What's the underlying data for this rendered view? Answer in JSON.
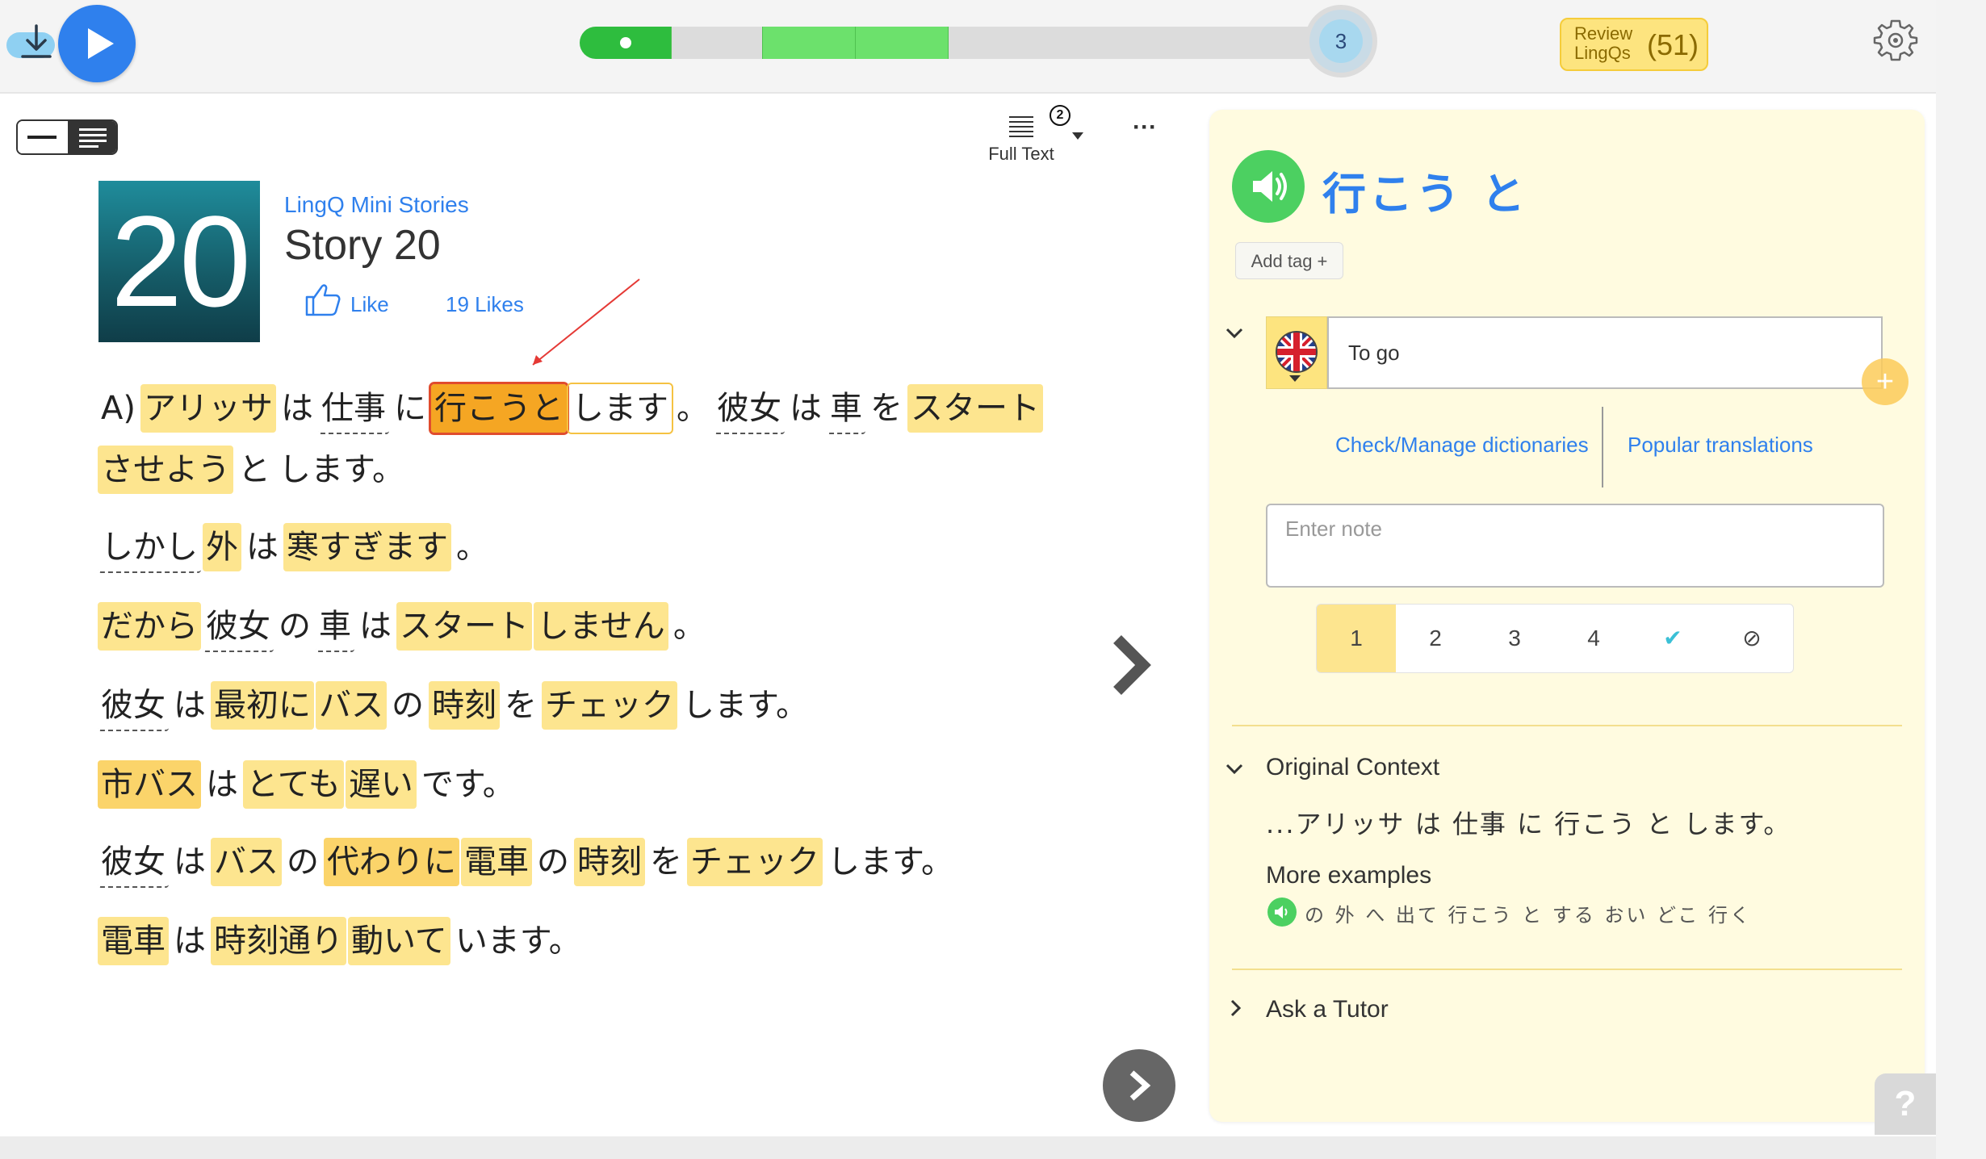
{
  "topbar": {
    "page_number": "3",
    "review_label": "Review LingQs",
    "review_count": "(51)",
    "progress_segments": [
      {
        "color": "#2ebd3e",
        "fraction": 0.123
      },
      {
        "color": "#dcdcdc",
        "fraction": 0.123
      },
      {
        "color": "#6ce16c",
        "fraction": 0.125
      },
      {
        "color": "#6ce16c",
        "fraction": 0.125
      },
      {
        "color": "#dcdcdc",
        "fraction": 0.504
      }
    ]
  },
  "toolbar": {
    "full_text_label": "Full Text",
    "full_text_badge": "2"
  },
  "lesson": {
    "cover_number": "20",
    "course": "LingQ Mini Stories",
    "title": "Story 20",
    "like_label": "Like",
    "likes_count": "19 Likes"
  },
  "paragraphs": [
    {
      "words": [
        {
          "t": "A)",
          "s": "plain"
        },
        {
          "t": "アリッサ",
          "s": "lingq"
        },
        {
          "t": "は",
          "s": "plain"
        },
        {
          "t": "仕事",
          "s": "known"
        },
        {
          "t": "に",
          "s": "plain"
        },
        {
          "t": "行こうと",
          "s": "selected"
        },
        {
          "t": "します",
          "s": "phrase"
        },
        {
          "t": "。",
          "s": "plain"
        },
        {
          "t": "彼女",
          "s": "known"
        },
        {
          "t": "は",
          "s": "plain"
        },
        {
          "t": "車",
          "s": "known"
        },
        {
          "t": "を",
          "s": "plain"
        },
        {
          "t": "スタート",
          "s": "lingq"
        }
      ]
    },
    {
      "words": [
        {
          "t": "させよう",
          "s": "lingq"
        },
        {
          "t": "と",
          "s": "plain"
        },
        {
          "t": "します。",
          "s": "plain"
        }
      ]
    },
    {
      "words": [
        {
          "t": "しかし",
          "s": "known"
        },
        {
          "t": "外",
          "s": "lingq"
        },
        {
          "t": "は",
          "s": "plain"
        },
        {
          "t": "寒すぎます",
          "s": "lingq"
        },
        {
          "t": "。",
          "s": "plain"
        }
      ]
    },
    {
      "words": [
        {
          "t": "だから",
          "s": "lingq"
        },
        {
          "t": "彼女",
          "s": "known"
        },
        {
          "t": "の",
          "s": "plain"
        },
        {
          "t": "車",
          "s": "known"
        },
        {
          "t": "は",
          "s": "plain"
        },
        {
          "t": "スタート",
          "s": "lingq"
        },
        {
          "t": "しません",
          "s": "lingq"
        },
        {
          "t": "。",
          "s": "plain"
        }
      ]
    },
    {
      "words": [
        {
          "t": "彼女",
          "s": "known"
        },
        {
          "t": "は",
          "s": "plain"
        },
        {
          "t": "最初に",
          "s": "lingq"
        },
        {
          "t": "バス",
          "s": "lingq"
        },
        {
          "t": "の",
          "s": "plain"
        },
        {
          "t": "時刻",
          "s": "lingq"
        },
        {
          "t": "を",
          "s": "plain"
        },
        {
          "t": "チェック",
          "s": "lingq"
        },
        {
          "t": "します。",
          "s": "plain"
        }
      ]
    },
    {
      "words": [
        {
          "t": "市バス",
          "s": "lingq2"
        },
        {
          "t": "は",
          "s": "plain"
        },
        {
          "t": "とても",
          "s": "lingq"
        },
        {
          "t": "遅い",
          "s": "lingq"
        },
        {
          "t": "です。",
          "s": "plain"
        }
      ]
    },
    {
      "words": [
        {
          "t": "彼女",
          "s": "known"
        },
        {
          "t": "は",
          "s": "plain"
        },
        {
          "t": "バス",
          "s": "lingq"
        },
        {
          "t": "の",
          "s": "plain"
        },
        {
          "t": "代わりに",
          "s": "lingq2"
        },
        {
          "t": "電車",
          "s": "lingq"
        },
        {
          "t": "の",
          "s": "plain"
        },
        {
          "t": "時刻",
          "s": "lingq"
        },
        {
          "t": "を",
          "s": "plain"
        },
        {
          "t": "チェック",
          "s": "lingq"
        },
        {
          "t": "します。",
          "s": "plain"
        }
      ]
    },
    {
      "words": [
        {
          "t": "電車",
          "s": "lingq"
        },
        {
          "t": "は",
          "s": "plain"
        },
        {
          "t": "時刻通り",
          "s": "lingq"
        },
        {
          "t": "動いて",
          "s": "lingq"
        },
        {
          "t": "います。",
          "s": "plain"
        }
      ]
    }
  ],
  "panel": {
    "term": "行こう と",
    "add_tag": "Add tag +",
    "meaning": "To go",
    "add_meaning": "+",
    "check_dictionaries": "Check/Manage dictionaries",
    "popular_translations": "Popular translations",
    "note_placeholder": "Enter note",
    "statuses": [
      "1",
      "2",
      "3",
      "4",
      "✔",
      "⊘"
    ],
    "selected_status": "1",
    "original_context_label": "Original Context",
    "original_context": "...アリッサ は 仕事 に 行こう と します。",
    "more_examples_label": "More examples",
    "more_examples": "の 外 へ 出て 行こう と する おい どこ 行く",
    "ask_tutor": "Ask a Tutor"
  },
  "help_label": "?",
  "colors": {
    "accent_blue": "#2f80ed",
    "lingq_yellow": "#fde58f",
    "selected_orange": "#f5a623",
    "audio_green": "#4cd061",
    "panel_bg": "#fffbe0"
  }
}
